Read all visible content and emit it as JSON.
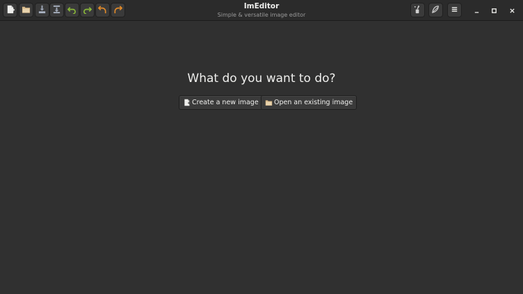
{
  "app": {
    "title": "ImEditor",
    "subtitle": "Simple & versatile image editor"
  },
  "toolbar": {
    "new_image": "new-image-icon",
    "open_image": "open-folder-icon",
    "save": "save-icon",
    "save_as": "save-as-icon",
    "undo": "undo-icon",
    "redo": "redo-icon",
    "rotate_left": "rotate-left-icon",
    "rotate_right": "rotate-right-icon"
  },
  "header_right": {
    "tool_a": "paint-tool-icon",
    "tool_b": "filter-icon",
    "menu": "hamburger-menu-icon"
  },
  "main": {
    "question": "What do you want to do?",
    "create_label": "Create a new image",
    "open_label": "Open an existing image"
  },
  "colors": {
    "background": "#303030",
    "headerbar": "#2b2b2b",
    "button": "#3a3a3a",
    "undo_green": "#8ab839",
    "rotate_orange": "#e08a2a"
  }
}
